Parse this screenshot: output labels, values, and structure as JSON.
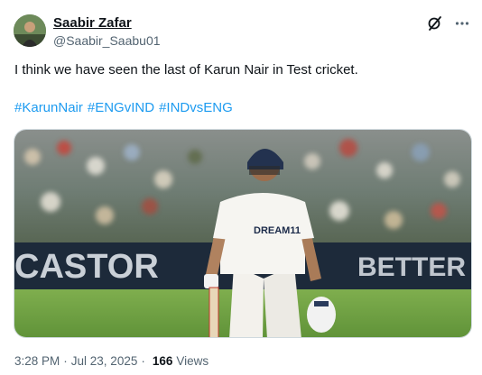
{
  "author": {
    "name": "Saabir Zafar",
    "handle": "@Saabir_Saabu01"
  },
  "tweet": {
    "text": "I think we have seen the last of Karun Nair in Test cricket.",
    "hashtags": [
      "#KarunNair",
      "#ENGvIND",
      "#INDvsENG"
    ]
  },
  "media": {
    "shirt_text": "DREAM11",
    "board_text": "CASTOR",
    "board_text_right": "BETTER"
  },
  "meta": {
    "time": "3:28 PM",
    "date": "Jul 23, 2025",
    "separator": "·",
    "views_count": "166",
    "views_label": "Views"
  },
  "icons": {
    "grok": "grok-icon",
    "more": "more-icon"
  },
  "colors": {
    "link": "#1d9bf0",
    "secondary_text": "#536471"
  }
}
